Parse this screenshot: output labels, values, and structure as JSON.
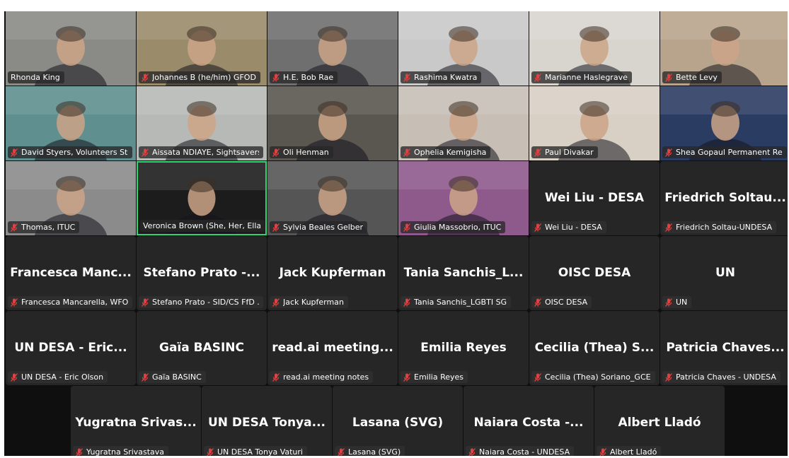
{
  "meeting": {
    "accent_active": "#2ed573",
    "muted_icon": "mic-off-icon",
    "muted_color": "#e04040",
    "rows": [
      [
        {
          "tag": "Rhonda King",
          "video": true,
          "muted": false,
          "bg": "#8a8a86"
        },
        {
          "tag": "Johannes B (he/him) GFOD",
          "video": true,
          "muted": true,
          "bg": "#9a8b6a"
        },
        {
          "tag": "H.E. Bob Rae",
          "video": true,
          "muted": true,
          "bg": "#6f6f6f"
        },
        {
          "tag": "Rashima Kwatra",
          "video": true,
          "muted": true,
          "bg": "#c9c9c9"
        },
        {
          "tag": "Marianne Haslegrave",
          "video": true,
          "muted": true,
          "bg": "#d8d4ce"
        },
        {
          "tag": "Bette Levy",
          "video": true,
          "muted": true,
          "bg": "#b8a48c"
        }
      ],
      [
        {
          "tag": "David Styers, Volunteers Sta...",
          "video": true,
          "muted": true,
          "bg": "#5f8f8f"
        },
        {
          "tag": "Aissata NDIAYE, Sightsavers",
          "video": true,
          "muted": true,
          "bg": "#b7b9b6"
        },
        {
          "tag": "Oli Henman",
          "video": true,
          "muted": true,
          "bg": "#5a5650"
        },
        {
          "tag": "Ophelia Kemigisha",
          "video": true,
          "muted": true,
          "bg": "#c7bfb6"
        },
        {
          "tag": "Paul Divakar",
          "video": true,
          "muted": true,
          "bg": "#d8d0c4"
        },
        {
          "tag": "Shea Gopaul Permanent Rep...",
          "video": true,
          "muted": true,
          "bg": "#2b3c63"
        }
      ],
      [
        {
          "tag": "Thomas, ITUC",
          "video": true,
          "muted": true,
          "bg": "#8b8b8b"
        },
        {
          "tag": "Veronica Brown (She, Her, Ella)",
          "video": true,
          "muted": false,
          "active": true,
          "bg": "#1c1c1c"
        },
        {
          "tag": "Sylvia Beales Gelber",
          "video": true,
          "muted": true,
          "bg": "#555555"
        },
        {
          "tag": "Giulia Massobrio, ITUC",
          "video": true,
          "muted": true,
          "bg": "#8e5a8c"
        },
        {
          "display": "Wei Liu - DESA",
          "tag": "Wei Liu - DESA",
          "video": false,
          "muted": true
        },
        {
          "display": "Friedrich Soltau...",
          "tag": "Friedrich Soltau-UNDESA",
          "video": false,
          "muted": true
        }
      ],
      [
        {
          "display": "Francesca Manc...",
          "tag": "Francesca Mancarella, WFO",
          "video": false,
          "muted": true
        },
        {
          "display": "Stefano Prato -...",
          "tag": "Stefano Prato - SID/CS FfD ...",
          "video": false,
          "muted": true
        },
        {
          "display": "Jack Kupferman",
          "tag": "Jack Kupferman",
          "video": false,
          "muted": true
        },
        {
          "display": "Tania Sanchis_L...",
          "tag": "Tania Sanchis_LGBTI SG",
          "video": false,
          "muted": true
        },
        {
          "display": "OISC DESA",
          "tag": "OISC DESA",
          "video": false,
          "muted": true
        },
        {
          "display": "UN",
          "tag": "UN",
          "video": false,
          "muted": true
        }
      ],
      [
        {
          "display": "UN DESA - Eric...",
          "tag": "UN DESA - Eric Olson",
          "video": false,
          "muted": true
        },
        {
          "display": "Gaïa BASINC",
          "tag": "Gaïa BASINC",
          "video": false,
          "muted": true
        },
        {
          "display": "read.ai meeting...",
          "tag": "read.ai meeting notes",
          "video": false,
          "muted": true
        },
        {
          "display": "Emilia Reyes",
          "tag": "Emilia Reyes",
          "video": false,
          "muted": true
        },
        {
          "display": "Cecilia (Thea) S...",
          "tag": "Cecilia (Thea) Soriano_GCE",
          "video": false,
          "muted": true
        },
        {
          "display": "Patricia Chaves...",
          "tag": "Patricia Chaves - UNDESA",
          "video": false,
          "muted": true
        }
      ],
      [
        {
          "display": "Yugratna Srivas...",
          "tag": "Yugratna Srivastava",
          "video": false,
          "muted": true
        },
        {
          "display": "UN DESA Tonya...",
          "tag": "UN DESA Tonya Vaturi",
          "video": false,
          "muted": true
        },
        {
          "display": "Lasana (SVG)",
          "tag": "Lasana (SVG)",
          "video": false,
          "muted": true
        },
        {
          "display": "Naiara Costa -...",
          "tag": "Naiara Costa - UNDESA",
          "video": false,
          "muted": true
        },
        {
          "display": "Albert Lladó",
          "tag": "Albert Lladó",
          "video": false,
          "muted": true
        }
      ]
    ]
  }
}
